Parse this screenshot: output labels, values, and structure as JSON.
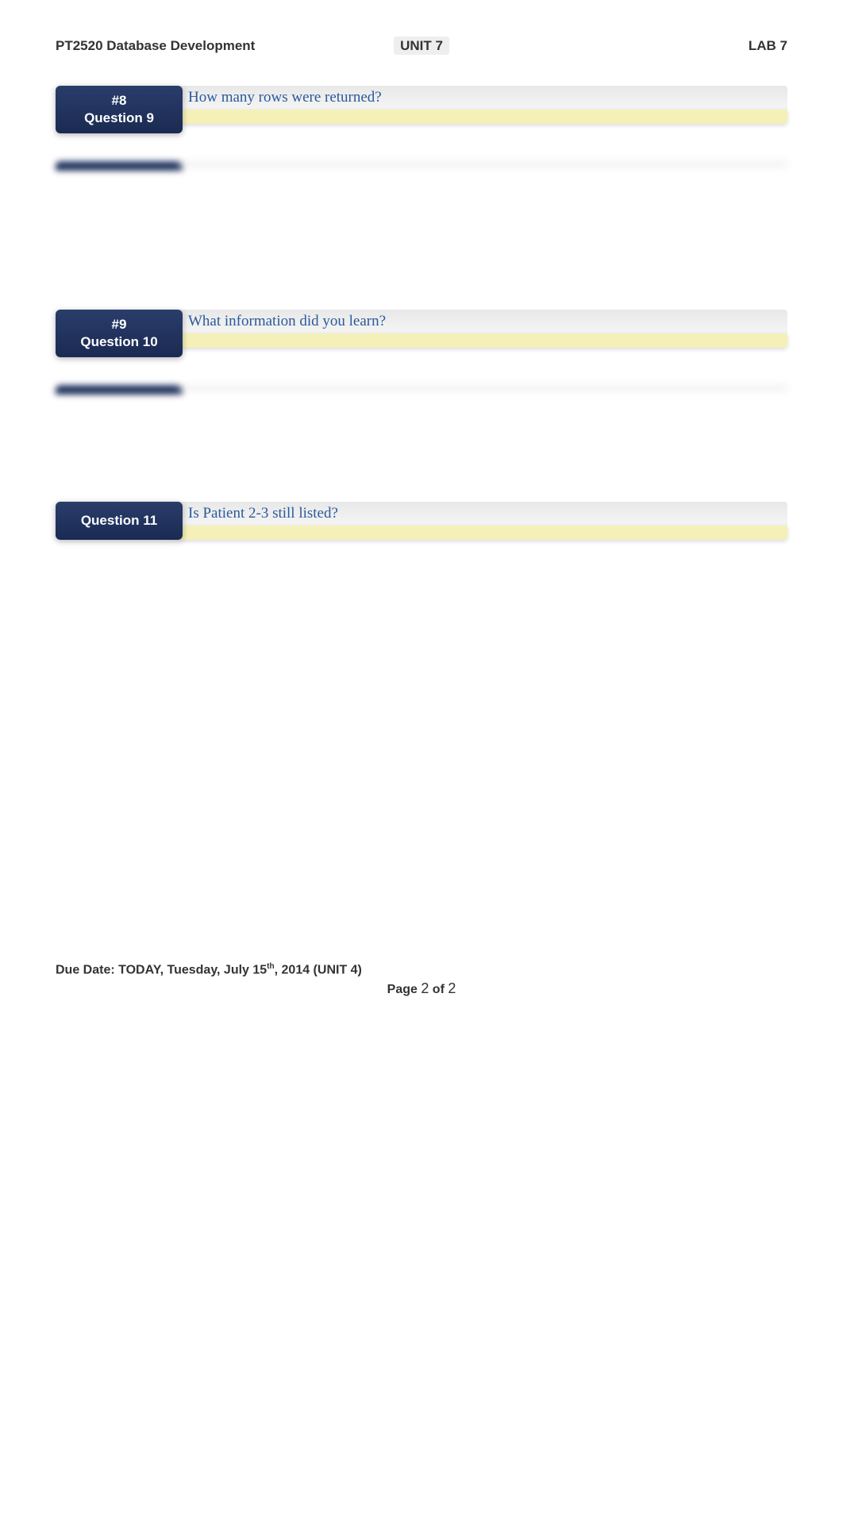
{
  "header": {
    "course": "PT2520 Database Development",
    "unit": "UNIT 7",
    "lab": "LAB 7"
  },
  "questions": [
    {
      "number": "#8",
      "label": "Question 9",
      "text": "How many rows were returned?"
    },
    {
      "number": "#9",
      "label": "Question 10",
      "text": "What information did you learn?"
    },
    {
      "number": "",
      "label": "Question 11",
      "text": "Is Patient 2-3 still listed?"
    }
  ],
  "footer": {
    "due_date_prefix": "Due Date: TODAY, Tuesday, July 15",
    "due_date_suffix": ", 2014 (UNIT 4)",
    "page_prefix": "Page ",
    "page_current": "2",
    "page_of": " of ",
    "page_total": "2"
  }
}
